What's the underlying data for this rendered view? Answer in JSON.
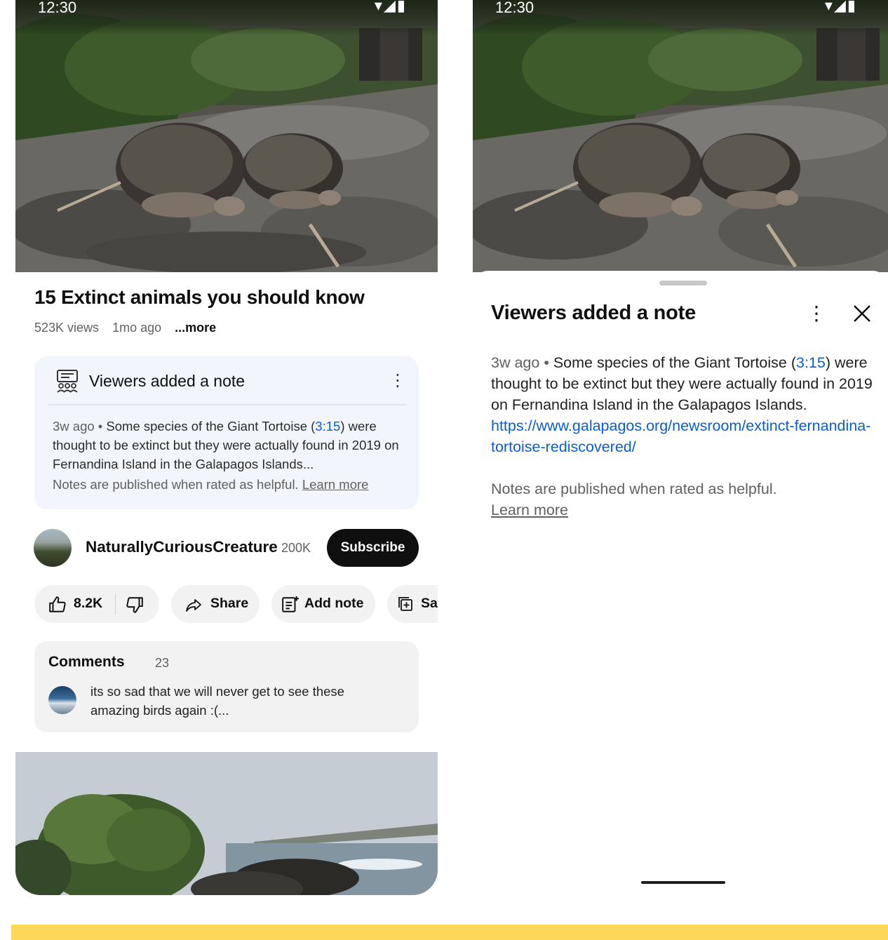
{
  "status": {
    "time": "12:30",
    "icons": "▾◢▮"
  },
  "video": {
    "title": "15 Extinct animals you should know",
    "views": "523K views",
    "age": "1mo ago",
    "more_label": "...more"
  },
  "note_card": {
    "title": "Viewers added a note",
    "age": "3w ago",
    "bullet": " • ",
    "text_before": "Some species of the Giant Tortoise (",
    "timestamp": "3:15",
    "text_after": ") were thought to be extinct but they were actually found in 2019 on Fernandina Island in the Galapagos Islands...",
    "footer_text": "Notes are published when rated as helpful. ",
    "learn_more": "Learn more"
  },
  "channel": {
    "name": "NaturallyCuriousCreature",
    "subscribers": "200K",
    "subscribe_label": "Subscribe"
  },
  "actions": {
    "likes": "8.2K",
    "share": "Share",
    "add_note": "Add note",
    "save": "Sa"
  },
  "comments": {
    "header": "Comments",
    "count": "23",
    "top_comment": "its so sad that we will never get to see these amazing birds again :(..."
  },
  "sheet": {
    "title": "Viewers added a note",
    "age": "3w ago",
    "bullet": " • ",
    "text_before": "Some species of the Giant Tortoise (",
    "timestamp": "3:15",
    "text_after": ") were thought to be extinct but they were actually found in 2019 on Fernandina Island in the Galapagos Islands. ",
    "link": "https://www.galapagos.org/newsroom/extinct-fernandina-tortoise-rediscovered/",
    "footer_text": "Notes are published when rated as helpful.",
    "learn_more": "Learn more"
  },
  "colors": {
    "accent_link": "#065fd4",
    "note_card_bg": "#f2f6fc",
    "chip_bg": "#f2f2f2",
    "highlight_bar": "#fcd75a"
  },
  "icons": {
    "like": "thumb-up-icon",
    "dislike": "thumb-down-icon",
    "share": "share-arrow-icon",
    "add_note": "add-note-icon",
    "save": "save-playlist-icon",
    "note": "community-note-icon",
    "more": "more-vert-icon",
    "close": "close-icon"
  }
}
